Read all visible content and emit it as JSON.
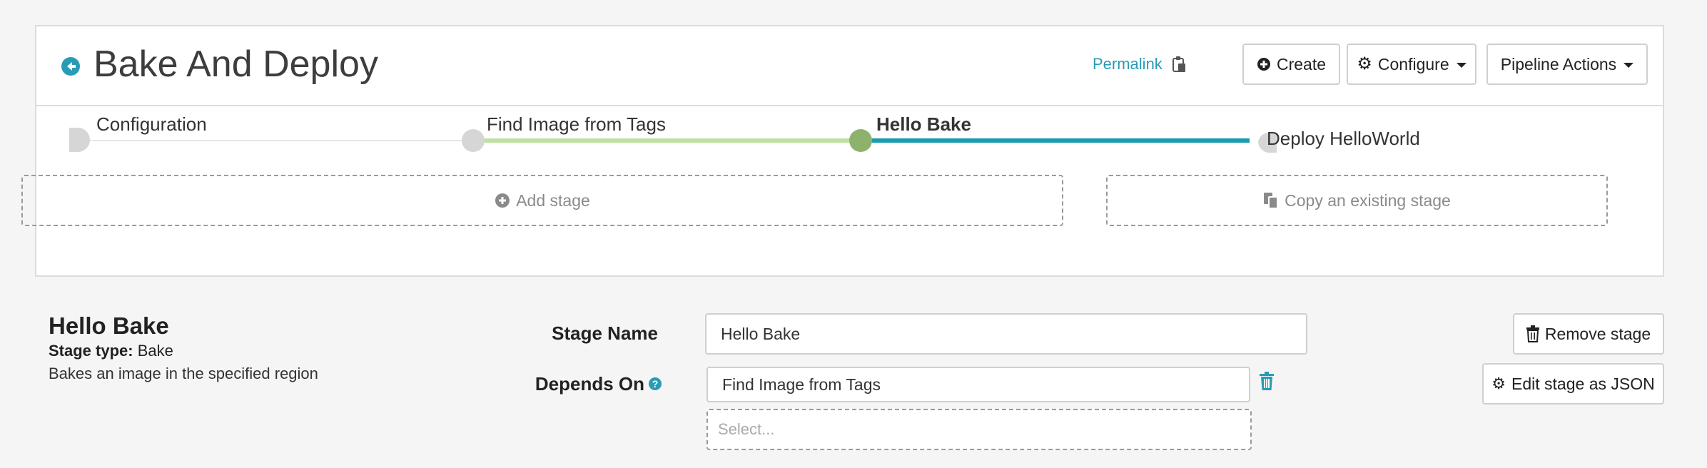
{
  "header": {
    "title": "Bake And Deploy",
    "permalink_label": "Permalink",
    "create_label": "Create",
    "configure_label": "Configure",
    "pipeline_actions_label": "Pipeline Actions"
  },
  "graph": {
    "stages": [
      {
        "label": "Configuration",
        "state": "config"
      },
      {
        "label": "Find Image from Tags",
        "state": "inactive"
      },
      {
        "label": "Hello Bake",
        "state": "active"
      },
      {
        "label": "Deploy HelloWorld",
        "state": "inactive"
      }
    ],
    "add_stage_label": "Add stage",
    "copy_stage_label": "Copy an existing stage"
  },
  "stage": {
    "title": "Hello Bake",
    "type_label": "Stage type:",
    "type_value": "Bake",
    "description": "Bakes an image in the specified region",
    "name_label": "Stage Name",
    "name_value": "Hello Bake",
    "depends_label": "Depends On",
    "depends_value": "Find Image from Tags",
    "select_placeholder": "Select...",
    "remove_label": "Remove stage",
    "edit_json_label": "Edit stage as JSON"
  },
  "colors": {
    "accent": "#2a9bb5",
    "edge_light": "#bfe0a4",
    "node_active": "#8db26e",
    "node_inactive": "#d6d6d6"
  }
}
